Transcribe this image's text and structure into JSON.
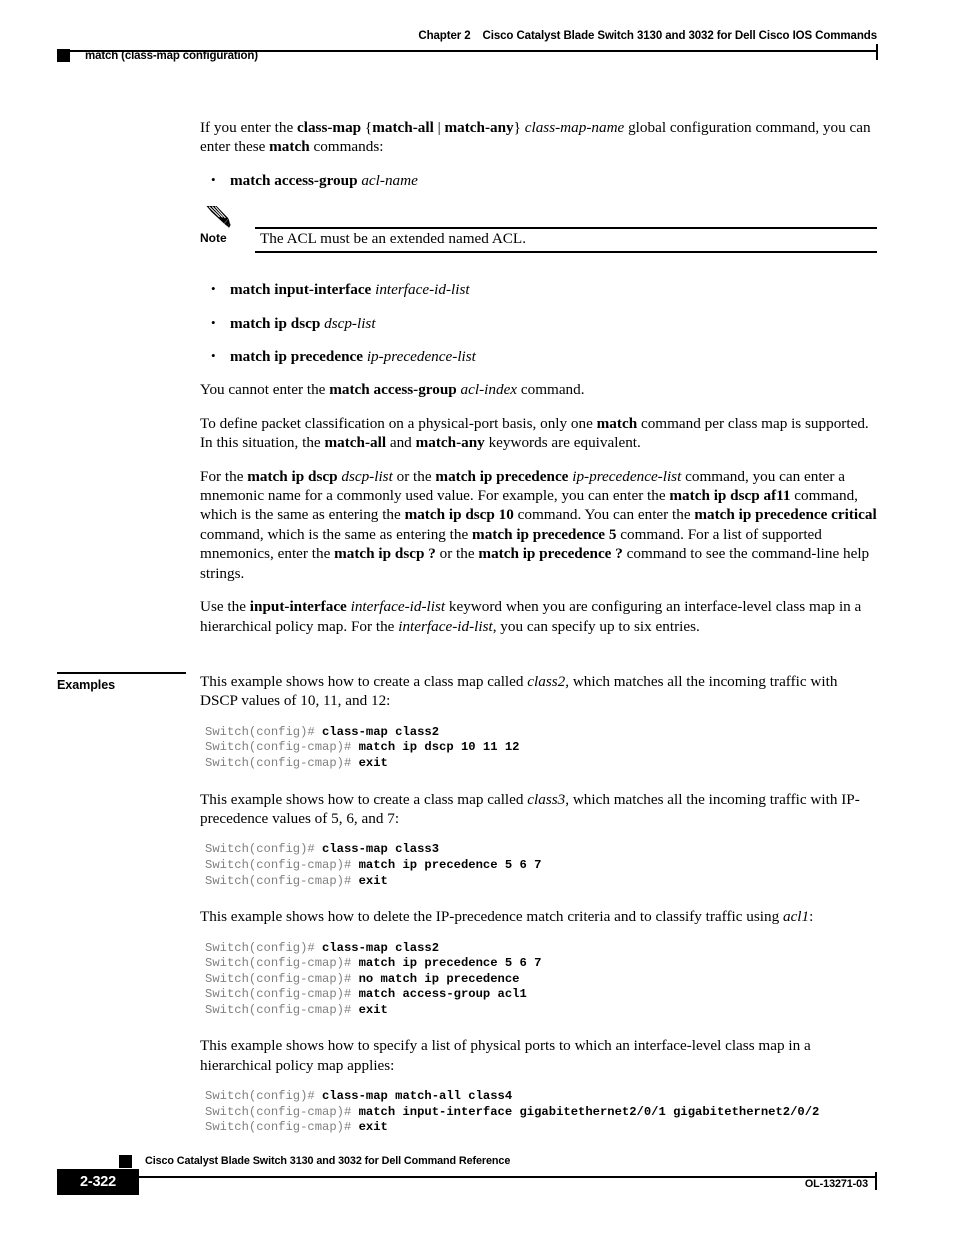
{
  "header": {
    "chapter": "Chapter 2",
    "title": "Cisco Catalyst Blade Switch 3130 and 3032 for Dell Cisco IOS Commands",
    "running_head": "match (class-map configuration)"
  },
  "body": {
    "intro": {
      "p1_a": "If you enter the ",
      "p1_b1": "class-map",
      "p1_c": " {",
      "p1_b2": "match-all",
      "p1_d": " | ",
      "p1_b3": "match-any",
      "p1_e": "} ",
      "p1_i1": "class-map-name",
      "p1_f": " global configuration command, you can enter these ",
      "p1_b4": "match",
      "p1_g": " commands:"
    },
    "bullet_first": {
      "bold": "match access-group",
      "italic": "acl-name"
    },
    "note": {
      "icon": "pencil-icon",
      "label": "Note",
      "text": "The ACL must be an extended named ACL."
    },
    "bullets": [
      {
        "bold": "match input-interface",
        "italic": "interface-id-list"
      },
      {
        "bold": "match ip dscp",
        "italic": "dscp-list"
      },
      {
        "bold": "match ip precedence",
        "italic": "ip-precedence-list"
      }
    ],
    "p_cannot": {
      "a": "You cannot enter the ",
      "b": "match access-group",
      "c": " ",
      "i": "acl-index",
      "d": " command."
    },
    "p_physical": {
      "a": "To define packet classification on a physical-port basis, only one ",
      "b1": "match",
      "b": " command per class map is supported. In this situation, the ",
      "b2": "match-all",
      "c": " and ",
      "b3": "match-any",
      "d": " keywords are equivalent."
    },
    "p_mnemonic": {
      "a": "For the ",
      "b1": "match ip dscp",
      "b": " ",
      "i1": "dscp-list",
      "c": " or the ",
      "b2": "match ip precedence",
      "d": " ",
      "i2": "ip-precedence-list",
      "e": " command, you can enter a mnemonic name for a commonly used value. For example, you can enter the ",
      "b3": "match ip dscp af11",
      "f": " command, which is the same as entering the ",
      "b4": "match ip dscp 10",
      "g": " command. You can enter the ",
      "b5": "match ip precedence critical",
      "h": " command, which is the same as entering the ",
      "b6": "match ip precedence 5",
      "j": " command. For a list of supported mnemonics, enter the ",
      "b7": "match ip dscp ?",
      "k": " or the ",
      "b8": "match ip precedence ?",
      "l": " command to see the command-line help strings."
    },
    "p_input_interface": {
      "a": "Use the ",
      "b1": "input-interface",
      "b": " ",
      "i1": "interface-id-list",
      "c": " keyword when you are configuring an interface-level class map in a hierarchical policy map. For the ",
      "i2": "interface-id-list",
      "d": ", you can specify up to six entries."
    }
  },
  "examples": {
    "label": "Examples",
    "items": [
      {
        "intro_a": "This example shows how to create a class map called ",
        "intro_i": "class2",
        "intro_b": ", which matches all the incoming traffic with DSCP values of 10, 11, and 12:",
        "lines": [
          {
            "prompt": "Switch(config)# ",
            "cmd": "class-map class2"
          },
          {
            "prompt": "Switch(config-cmap)# ",
            "cmd": "match ip dscp 10 11 12"
          },
          {
            "prompt": "Switch(config-cmap)# ",
            "cmd": "exit"
          }
        ]
      },
      {
        "intro_a": "This example shows how to create a class map called ",
        "intro_i": "class3",
        "intro_b": ", which matches all the incoming traffic with IP-precedence values of 5, 6, and 7:",
        "lines": [
          {
            "prompt": "Switch(config)# ",
            "cmd": "class-map class3"
          },
          {
            "prompt": "Switch(config-cmap)# ",
            "cmd": "match ip precedence 5 6 7"
          },
          {
            "prompt": "Switch(config-cmap)# ",
            "cmd": "exit"
          }
        ]
      },
      {
        "intro_a": "This example shows how to delete the IP-precedence match criteria and to classify traffic using ",
        "intro_i": "acl1",
        "intro_b": ":",
        "lines": [
          {
            "prompt": "Switch(config)# ",
            "cmd": "class-map class2"
          },
          {
            "prompt": "Switch(config-cmap)# ",
            "cmd": "match ip precedence 5 6 7"
          },
          {
            "prompt": "Switch(config-cmap)# ",
            "cmd": "no match ip precedence"
          },
          {
            "prompt": "Switch(config-cmap)# ",
            "cmd": "match access-group acl1"
          },
          {
            "prompt": "Switch(config-cmap)# ",
            "cmd": "exit"
          }
        ]
      },
      {
        "intro_a": "This example shows how to specify a list of physical ports to which an interface-level class map in a hierarchical policy map applies:",
        "intro_i": "",
        "intro_b": "",
        "lines": [
          {
            "prompt": "Switch(config)# ",
            "cmd": "class-map match-all class4"
          },
          {
            "prompt": "Switch(config-cmap)# ",
            "cmd": "match input-interface gigabitethernet2/0/1 gigabitethernet2/0/2"
          },
          {
            "prompt": "Switch(config-cmap)# ",
            "cmd": "exit"
          }
        ]
      }
    ]
  },
  "footer": {
    "title": "Cisco Catalyst Blade Switch 3130 and 3032 for Dell Command Reference",
    "page_number": "2-322",
    "doc_id": "OL-13271-03"
  }
}
